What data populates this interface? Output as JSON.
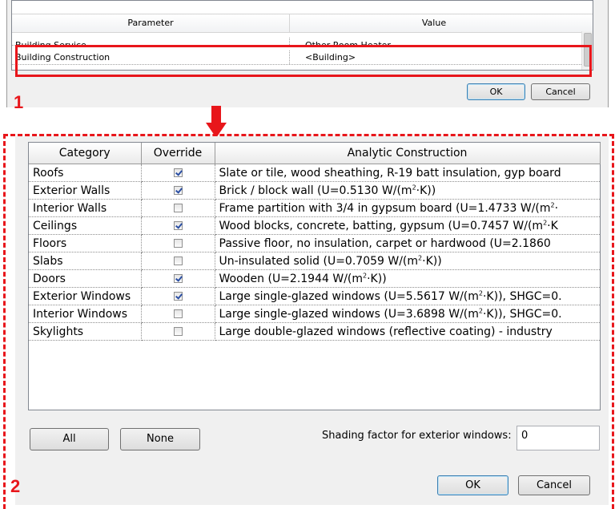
{
  "top_dialog": {
    "columns": {
      "parameter": "Parameter",
      "value": "Value"
    },
    "rows": [
      {
        "parameter": "Building Service",
        "value": "Other Room Heater"
      },
      {
        "parameter": "Building Construction",
        "value": "<Building>"
      }
    ],
    "ok_label": "OK",
    "cancel_label": "Cancel"
  },
  "annotations": {
    "step1": "1",
    "step2": "2",
    "accent_color": "#e8161b"
  },
  "construction_dialog": {
    "headers": {
      "category": "Category",
      "override": "Override",
      "analytic": "Analytic Construction"
    },
    "rows": [
      {
        "category": "Roofs",
        "override": true,
        "construction": "Slate or tile, wood sheathing, R-19 batt insulation, gyp board"
      },
      {
        "category": "Exterior Walls",
        "override": true,
        "construction_pre": "Brick / block wall (U=0.5130 W/(m",
        "construction_sup": "2",
        "construction_post": "·K))"
      },
      {
        "category": "Interior Walls",
        "override": false,
        "construction_pre": "Frame partition with 3/4 in gypsum board (U=1.4733 W/(m",
        "construction_sup": "2",
        "construction_post": "·"
      },
      {
        "category": "Ceilings",
        "override": true,
        "construction_pre": "Wood blocks, concrete, batting, gypsum (U=0.7457 W/(m",
        "construction_sup": "2",
        "construction_post": "·K"
      },
      {
        "category": "Floors",
        "override": false,
        "construction": "Passive floor, no insulation, carpet or hardwood (U=2.1860"
      },
      {
        "category": "Slabs",
        "override": false,
        "construction_pre": "Un-insulated solid (U=0.7059 W/(m",
        "construction_sup": "2",
        "construction_post": "·K))"
      },
      {
        "category": "Doors",
        "override": true,
        "construction_pre": "Wooden (U=2.1944 W/(m",
        "construction_sup": "2",
        "construction_post": "·K))"
      },
      {
        "category": "Exterior Windows",
        "override": true,
        "construction_pre": "Large single-glazed windows (U=5.5617 W/(m",
        "construction_sup": "2",
        "construction_post": "·K)), SHGC=0."
      },
      {
        "category": "Interior Windows",
        "override": false,
        "construction_pre": "Large single-glazed windows (U=3.6898 W/(m",
        "construction_sup": "2",
        "construction_post": "·K)), SHGC=0."
      },
      {
        "category": "Skylights",
        "override": false,
        "construction": "Large double-glazed windows (reflective coating) - industry"
      }
    ],
    "all_label": "All",
    "none_label": "None",
    "shading_label": "Shading factor for exterior windows:",
    "shading_value": "0",
    "ok_label": "OK",
    "cancel_label": "Cancel"
  }
}
